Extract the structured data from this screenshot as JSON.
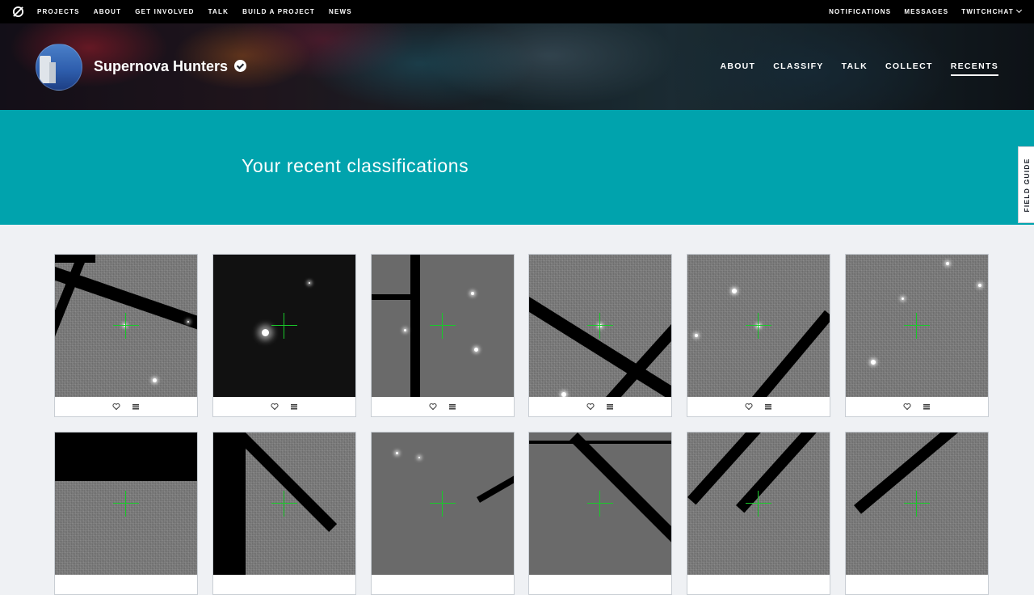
{
  "topnav": {
    "logo_icon": "zooniverse-logo-icon",
    "links": [
      "PROJECTS",
      "ABOUT",
      "GET INVOLVED",
      "TALK",
      "BUILD A PROJECT",
      "NEWS"
    ],
    "right": {
      "notifications": "NOTIFICATIONS",
      "messages": "MESSAGES",
      "user": "TWITCHCHAT"
    }
  },
  "project": {
    "title": "Supernova Hunters",
    "verified_icon": "verified-check-icon",
    "tabs": [
      "ABOUT",
      "CLASSIFY",
      "TALK",
      "COLLECT",
      "RECENTS"
    ],
    "active_tab": "RECENTS"
  },
  "banner": {
    "title": "Your recent classifications"
  },
  "field_guide": {
    "label": "FIELD GUIDE"
  },
  "recents": {
    "favorite_icon": "heart-icon",
    "collect_icon": "list-icon",
    "rows": 2,
    "per_row": 6
  },
  "colors": {
    "teal": "#00a3ad",
    "topnav": "#000000",
    "crosshair": "#19c92a"
  }
}
